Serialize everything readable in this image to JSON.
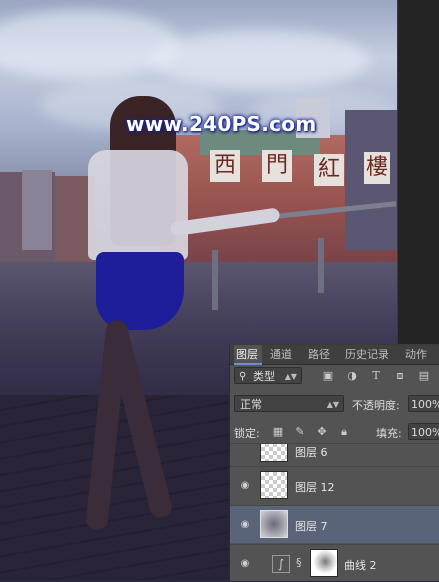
{
  "watermark": "www.240PS.com",
  "sign_chars": [
    "西",
    "門",
    "紅",
    "樓"
  ],
  "panel": {
    "tabs": [
      "图层",
      "通道",
      "路径",
      "历史记录",
      "动作"
    ],
    "active_tab": "图层",
    "filter_kind": "类型",
    "blend_mode": "正常",
    "opacity_label": "不透明度:",
    "opacity_value": "100%",
    "lock_label": "锁定:",
    "fill_label": "填充:",
    "fill_value": "100%",
    "layers": [
      {
        "name": "图层 6",
        "visible": false,
        "selected": false
      },
      {
        "name": "图层 12",
        "visible": true,
        "selected": false
      },
      {
        "name": "图层 7",
        "visible": true,
        "selected": true
      },
      {
        "name": "曲线 2",
        "visible": true,
        "selected": false
      }
    ]
  },
  "colors": {
    "panel_bg": "#535353",
    "tab_bar": "#3f3f3f",
    "selected_layer": "#5a6478",
    "watermark_glow": "#1a2a9a",
    "skirt": "#1e1e9a"
  }
}
